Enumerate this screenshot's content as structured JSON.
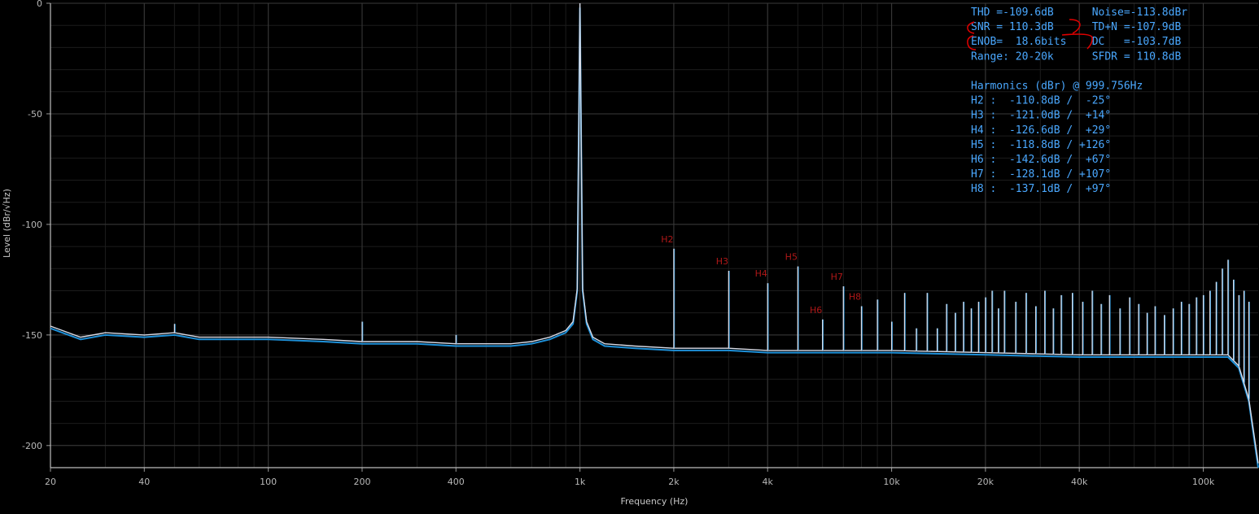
{
  "chart_data": {
    "type": "line",
    "xlabel": "Frequency (Hz)",
    "ylabel": "Level (dBr/√Hz)",
    "x_scale": "log",
    "xlim": [
      20,
      150000
    ],
    "ylim": [
      -210,
      0
    ],
    "x_ticks": [
      {
        "v": 20,
        "label": "20"
      },
      {
        "v": 40,
        "label": "40"
      },
      {
        "v": 100,
        "label": "100"
      },
      {
        "v": 200,
        "label": "200"
      },
      {
        "v": 400,
        "label": "400"
      },
      {
        "v": 1000,
        "label": "1k"
      },
      {
        "v": 2000,
        "label": "2k"
      },
      {
        "v": 4000,
        "label": "4k"
      },
      {
        "v": 10000,
        "label": "10k"
      },
      {
        "v": 20000,
        "label": "20k"
      },
      {
        "v": 40000,
        "label": "40k"
      },
      {
        "v": 100000,
        "label": "100k"
      }
    ],
    "y_ticks": [
      {
        "v": 0,
        "label": "0"
      },
      {
        "v": -50,
        "label": "-50"
      },
      {
        "v": -100,
        "label": "-100"
      },
      {
        "v": -150,
        "label": "-150"
      },
      {
        "v": -200,
        "label": "-200"
      }
    ],
    "grid": true,
    "series": [
      {
        "color": "#1e90d8",
        "x": [
          20,
          25,
          30,
          40,
          50,
          60,
          80,
          100,
          150,
          200,
          300,
          400,
          500,
          600,
          700,
          800,
          900,
          950,
          980,
          1000,
          1020,
          1050,
          1100,
          1200,
          1500,
          2000,
          3000,
          4000,
          6000,
          10000,
          20000,
          40000,
          60000,
          100000,
          120000,
          130000,
          140000,
          150000
        ],
        "y": [
          -147,
          -152,
          -150,
          -151,
          -150,
          -152,
          -152,
          -152,
          -153,
          -154,
          -154,
          -155,
          -155,
          -155,
          -154,
          -152,
          -149,
          -145,
          -130,
          -2,
          -130,
          -145,
          -152,
          -155,
          -156,
          -157,
          -157,
          -158,
          -158,
          -158,
          -159,
          -160,
          -160,
          -160,
          -160,
          -165,
          -180,
          -210
        ]
      },
      {
        "color": "#d8dce8",
        "x": [
          20,
          25,
          30,
          40,
          50,
          60,
          80,
          100,
          150,
          200,
          300,
          400,
          500,
          600,
          700,
          800,
          900,
          950,
          980,
          1000,
          1020,
          1050,
          1100,
          1200,
          1500,
          2000,
          3000,
          4000,
          6000,
          10000,
          20000,
          40000,
          60000,
          100000,
          120000,
          130000,
          140000,
          150000
        ],
        "y": [
          -146,
          -151,
          -149,
          -150,
          -149,
          -151,
          -151,
          -151,
          -152,
          -153,
          -153,
          -154,
          -154,
          -154,
          -153,
          -151,
          -148,
          -144,
          -129,
          0,
          -129,
          -144,
          -151,
          -154,
          -155,
          -156,
          -156,
          -157,
          -157,
          -157,
          -158,
          -159,
          -159,
          -159,
          -159,
          -164,
          -179,
          -208
        ]
      }
    ],
    "spikes": [
      {
        "f": 50,
        "level": -145
      },
      {
        "f": 200,
        "level": -144
      },
      {
        "f": 400,
        "level": -150
      },
      {
        "f": 2000,
        "level": -111
      },
      {
        "f": 3000,
        "level": -121
      },
      {
        "f": 4000,
        "level": -126.6
      },
      {
        "f": 5000,
        "level": -119
      },
      {
        "f": 6000,
        "level": -143
      },
      {
        "f": 7000,
        "level": -128
      },
      {
        "f": 8000,
        "level": -137
      },
      {
        "f": 9000,
        "level": -134
      },
      {
        "f": 10000,
        "level": -144
      },
      {
        "f": 11000,
        "level": -131
      },
      {
        "f": 12000,
        "level": -147
      },
      {
        "f": 13000,
        "level": -131
      },
      {
        "f": 14000,
        "level": -147
      },
      {
        "f": 15000,
        "level": -136
      },
      {
        "f": 16000,
        "level": -140
      },
      {
        "f": 17000,
        "level": -135
      },
      {
        "f": 18000,
        "level": -138
      },
      {
        "f": 19000,
        "level": -135
      },
      {
        "f": 20000,
        "level": -133
      },
      {
        "f": 21000,
        "level": -130
      },
      {
        "f": 22000,
        "level": -138
      },
      {
        "f": 23000,
        "level": -130
      },
      {
        "f": 25000,
        "level": -135
      },
      {
        "f": 27000,
        "level": -131
      },
      {
        "f": 29000,
        "level": -137
      },
      {
        "f": 31000,
        "level": -130
      },
      {
        "f": 33000,
        "level": -138
      },
      {
        "f": 35000,
        "level": -132
      },
      {
        "f": 38000,
        "level": -131
      },
      {
        "f": 41000,
        "level": -135
      },
      {
        "f": 44000,
        "level": -130
      },
      {
        "f": 47000,
        "level": -136
      },
      {
        "f": 50000,
        "level": -132
      },
      {
        "f": 54000,
        "level": -138
      },
      {
        "f": 58000,
        "level": -133
      },
      {
        "f": 62000,
        "level": -136
      },
      {
        "f": 66000,
        "level": -140
      },
      {
        "f": 70000,
        "level": -137
      },
      {
        "f": 75000,
        "level": -141
      },
      {
        "f": 80000,
        "level": -138
      },
      {
        "f": 85000,
        "level": -135
      },
      {
        "f": 90000,
        "level": -136
      },
      {
        "f": 95000,
        "level": -133
      },
      {
        "f": 100000,
        "level": -132
      },
      {
        "f": 105000,
        "level": -130
      },
      {
        "f": 110000,
        "level": -126
      },
      {
        "f": 115000,
        "level": -120
      },
      {
        "f": 120000,
        "level": -116
      },
      {
        "f": 125000,
        "level": -125
      },
      {
        "f": 130000,
        "level": -132
      },
      {
        "f": 135000,
        "level": -130
      },
      {
        "f": 140000,
        "level": -135
      }
    ],
    "harmonic_labels": [
      {
        "text": "H2",
        "f": 2000,
        "level": -111
      },
      {
        "text": "H3",
        "f": 3000,
        "level": -121
      },
      {
        "text": "H4",
        "f": 4000,
        "level": -126.6
      },
      {
        "text": "H5",
        "f": 5000,
        "level": -119
      },
      {
        "text": "H6",
        "f": 6000,
        "level": -143
      },
      {
        "text": "H7",
        "f": 7000,
        "level": -128
      },
      {
        "text": "H8",
        "f": 8000,
        "level": -137
      }
    ],
    "stats": [
      "THD =-109.6dB      Noise=-113.8dBr",
      "SNR = 110.3dB      TD+N =-107.9dB",
      "ENOB=  18.6bits    DC   =-103.7dB",
      "Range: 20-20k      SFDR = 110.8dB",
      "",
      "Harmonics (dBr) @ 999.756Hz",
      "H2 :  -110.8dB /  -25°",
      "H3 :  -121.0dB /  +14°",
      "H4 :  -126.6dB /  +29°",
      "H5 :  -118.8dB / +126°",
      "H6 :  -142.6dB /  +67°",
      "H7 :  -128.1dB / +107°",
      "H8 :  -137.1dB /  +97°"
    ],
    "annotation_color": "#e00000"
  }
}
